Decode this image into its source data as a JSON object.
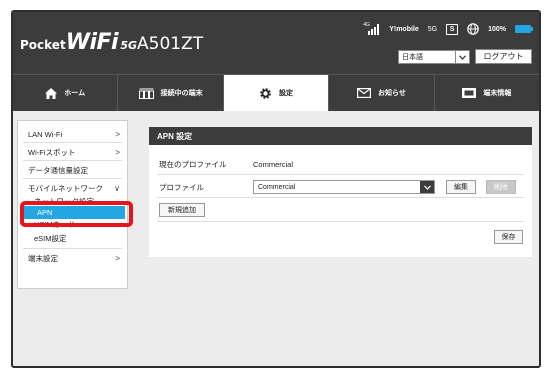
{
  "header": {
    "logo_pocket": "Pocket",
    "logo_wifi": "WiFi",
    "logo_5g": "5G",
    "logo_model": "A501ZT",
    "signal_label": "4G",
    "carrier": "Y!mobile",
    "network": "5G",
    "sim_label": "S",
    "battery": "100%",
    "battery_color": "#22a7e3",
    "language_value": "日本語",
    "logout_label": "ログアウト"
  },
  "nav": {
    "tabs": [
      {
        "label": "ホーム",
        "icon": "home-icon",
        "active": false
      },
      {
        "label": "接続中の端末",
        "icon": "devices-icon",
        "active": false
      },
      {
        "label": "設定",
        "icon": "gear-icon",
        "active": true
      },
      {
        "label": "お知らせ",
        "icon": "mail-icon",
        "active": false
      },
      {
        "label": "端末情報",
        "icon": "device-info-icon",
        "active": false
      }
    ]
  },
  "sidebar": {
    "items": [
      {
        "label": "LAN Wi-Fi",
        "chevron": ">"
      },
      {
        "label": "Wi-Fiスポット",
        "chevron": ">"
      },
      {
        "label": "データ通信量設定",
        "chevron": ""
      },
      {
        "label": "モバイルネットワーク",
        "chevron": "∨"
      },
      {
        "label": "端末設定",
        "chevron": ">"
      }
    ],
    "sub_items": [
      {
        "label": "ネットワーク設定"
      },
      {
        "label": "APN",
        "selected": true
      },
      {
        "label": "USIMカード"
      },
      {
        "label": "eSIM設定"
      }
    ]
  },
  "main": {
    "title": "APN 設定",
    "current_profile_label": "現在のプロファイル",
    "current_profile_value": "Commercial",
    "profile_label": "プロファイル",
    "profile_value": "Commercial",
    "edit_label": "編集",
    "delete_label": "削除",
    "new_label": "新規追加",
    "save_label": "保存"
  },
  "colors": {
    "accent": "#22a7e3",
    "header": "#3c3c3c",
    "highlight": "#e8141b"
  }
}
